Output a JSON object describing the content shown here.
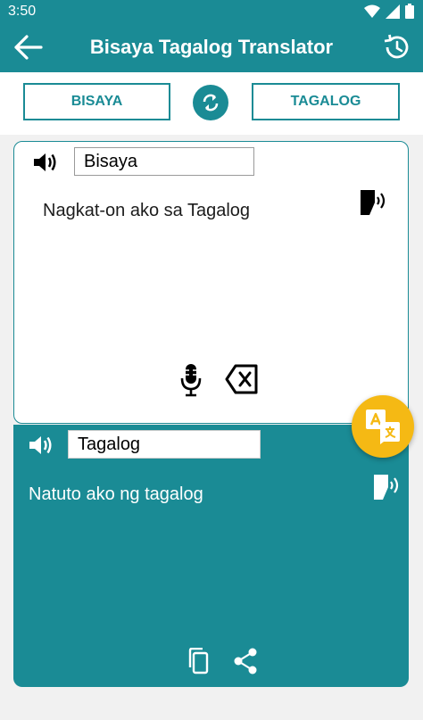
{
  "status": {
    "time": "3:50"
  },
  "appbar": {
    "title": "Bisaya Tagalog Translator"
  },
  "languages": {
    "source": "BISAYA",
    "target": "TAGALOG"
  },
  "source_panel": {
    "language_name": "Bisaya",
    "text": "Nagkat-on ako sa Tagalog"
  },
  "target_panel": {
    "language_name": "Tagalog",
    "text": "Natuto ako ng tagalog"
  },
  "colors": {
    "primary": "#1a8b95",
    "accent": "#f5b914"
  },
  "icons": [
    "back-arrow-icon",
    "history-icon",
    "swap-icon",
    "speaker-icon",
    "speak-aloud-icon",
    "microphone-icon",
    "backspace-icon",
    "translate-icon",
    "copy-icon",
    "share-icon"
  ]
}
